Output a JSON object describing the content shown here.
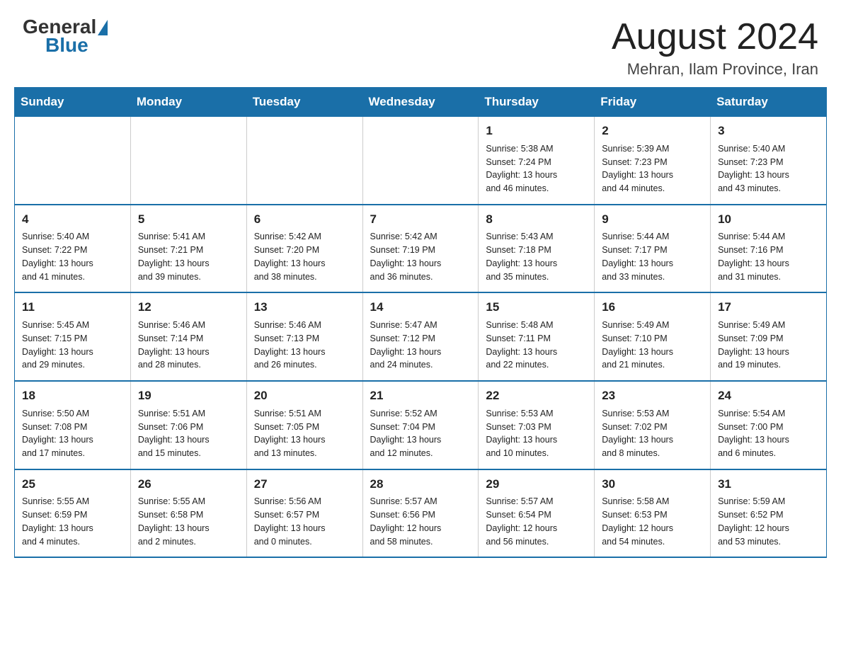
{
  "header": {
    "logo_general": "General",
    "logo_blue": "Blue",
    "month_title": "August 2024",
    "location": "Mehran, Ilam Province, Iran"
  },
  "weekdays": [
    "Sunday",
    "Monday",
    "Tuesday",
    "Wednesday",
    "Thursday",
    "Friday",
    "Saturday"
  ],
  "weeks": [
    [
      {
        "day": "",
        "info": ""
      },
      {
        "day": "",
        "info": ""
      },
      {
        "day": "",
        "info": ""
      },
      {
        "day": "",
        "info": ""
      },
      {
        "day": "1",
        "info": "Sunrise: 5:38 AM\nSunset: 7:24 PM\nDaylight: 13 hours\nand 46 minutes."
      },
      {
        "day": "2",
        "info": "Sunrise: 5:39 AM\nSunset: 7:23 PM\nDaylight: 13 hours\nand 44 minutes."
      },
      {
        "day": "3",
        "info": "Sunrise: 5:40 AM\nSunset: 7:23 PM\nDaylight: 13 hours\nand 43 minutes."
      }
    ],
    [
      {
        "day": "4",
        "info": "Sunrise: 5:40 AM\nSunset: 7:22 PM\nDaylight: 13 hours\nand 41 minutes."
      },
      {
        "day": "5",
        "info": "Sunrise: 5:41 AM\nSunset: 7:21 PM\nDaylight: 13 hours\nand 39 minutes."
      },
      {
        "day": "6",
        "info": "Sunrise: 5:42 AM\nSunset: 7:20 PM\nDaylight: 13 hours\nand 38 minutes."
      },
      {
        "day": "7",
        "info": "Sunrise: 5:42 AM\nSunset: 7:19 PM\nDaylight: 13 hours\nand 36 minutes."
      },
      {
        "day": "8",
        "info": "Sunrise: 5:43 AM\nSunset: 7:18 PM\nDaylight: 13 hours\nand 35 minutes."
      },
      {
        "day": "9",
        "info": "Sunrise: 5:44 AM\nSunset: 7:17 PM\nDaylight: 13 hours\nand 33 minutes."
      },
      {
        "day": "10",
        "info": "Sunrise: 5:44 AM\nSunset: 7:16 PM\nDaylight: 13 hours\nand 31 minutes."
      }
    ],
    [
      {
        "day": "11",
        "info": "Sunrise: 5:45 AM\nSunset: 7:15 PM\nDaylight: 13 hours\nand 29 minutes."
      },
      {
        "day": "12",
        "info": "Sunrise: 5:46 AM\nSunset: 7:14 PM\nDaylight: 13 hours\nand 28 minutes."
      },
      {
        "day": "13",
        "info": "Sunrise: 5:46 AM\nSunset: 7:13 PM\nDaylight: 13 hours\nand 26 minutes."
      },
      {
        "day": "14",
        "info": "Sunrise: 5:47 AM\nSunset: 7:12 PM\nDaylight: 13 hours\nand 24 minutes."
      },
      {
        "day": "15",
        "info": "Sunrise: 5:48 AM\nSunset: 7:11 PM\nDaylight: 13 hours\nand 22 minutes."
      },
      {
        "day": "16",
        "info": "Sunrise: 5:49 AM\nSunset: 7:10 PM\nDaylight: 13 hours\nand 21 minutes."
      },
      {
        "day": "17",
        "info": "Sunrise: 5:49 AM\nSunset: 7:09 PM\nDaylight: 13 hours\nand 19 minutes."
      }
    ],
    [
      {
        "day": "18",
        "info": "Sunrise: 5:50 AM\nSunset: 7:08 PM\nDaylight: 13 hours\nand 17 minutes."
      },
      {
        "day": "19",
        "info": "Sunrise: 5:51 AM\nSunset: 7:06 PM\nDaylight: 13 hours\nand 15 minutes."
      },
      {
        "day": "20",
        "info": "Sunrise: 5:51 AM\nSunset: 7:05 PM\nDaylight: 13 hours\nand 13 minutes."
      },
      {
        "day": "21",
        "info": "Sunrise: 5:52 AM\nSunset: 7:04 PM\nDaylight: 13 hours\nand 12 minutes."
      },
      {
        "day": "22",
        "info": "Sunrise: 5:53 AM\nSunset: 7:03 PM\nDaylight: 13 hours\nand 10 minutes."
      },
      {
        "day": "23",
        "info": "Sunrise: 5:53 AM\nSunset: 7:02 PM\nDaylight: 13 hours\nand 8 minutes."
      },
      {
        "day": "24",
        "info": "Sunrise: 5:54 AM\nSunset: 7:00 PM\nDaylight: 13 hours\nand 6 minutes."
      }
    ],
    [
      {
        "day": "25",
        "info": "Sunrise: 5:55 AM\nSunset: 6:59 PM\nDaylight: 13 hours\nand 4 minutes."
      },
      {
        "day": "26",
        "info": "Sunrise: 5:55 AM\nSunset: 6:58 PM\nDaylight: 13 hours\nand 2 minutes."
      },
      {
        "day": "27",
        "info": "Sunrise: 5:56 AM\nSunset: 6:57 PM\nDaylight: 13 hours\nand 0 minutes."
      },
      {
        "day": "28",
        "info": "Sunrise: 5:57 AM\nSunset: 6:56 PM\nDaylight: 12 hours\nand 58 minutes."
      },
      {
        "day": "29",
        "info": "Sunrise: 5:57 AM\nSunset: 6:54 PM\nDaylight: 12 hours\nand 56 minutes."
      },
      {
        "day": "30",
        "info": "Sunrise: 5:58 AM\nSunset: 6:53 PM\nDaylight: 12 hours\nand 54 minutes."
      },
      {
        "day": "31",
        "info": "Sunrise: 5:59 AM\nSunset: 6:52 PM\nDaylight: 12 hours\nand 53 minutes."
      }
    ]
  ]
}
